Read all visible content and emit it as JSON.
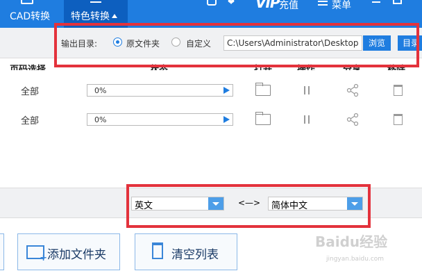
{
  "topbar": {
    "tabs": [
      {
        "label": "CAD转换"
      },
      {
        "label": "特色转换"
      }
    ],
    "vip_badge": "VIP",
    "vip_text": "充值",
    "menu_text": "菜单",
    "icons": [
      "user-icon",
      "heart-icon",
      "menu-icon",
      "minimize-icon",
      "maximize-icon"
    ]
  },
  "output": {
    "label": "输出目录:",
    "options": [
      "原文件夹",
      "自定义"
    ],
    "selected": "原文件夹",
    "path": "C:\\Users\\Administrator\\Desktop",
    "browse_label": "浏览",
    "open_label": "目录"
  },
  "table": {
    "headers": [
      "页码选择",
      "状态",
      "打开",
      "操作",
      "分享",
      "移除"
    ],
    "rows": [
      {
        "pages": "全部",
        "progress": "0%"
      },
      {
        "pages": "全部",
        "progress": "0%"
      }
    ]
  },
  "language": {
    "source": "英文",
    "swap": "<—>",
    "target": "简体中文"
  },
  "bottom": {
    "add_folder": "添加文件夹",
    "clear_list": "清空列表"
  },
  "watermark": {
    "text": "Baidu经验",
    "url": "jingyan.baidu.com"
  },
  "colors": {
    "accent": "#1f7de0",
    "highlight": "#e3323c"
  }
}
